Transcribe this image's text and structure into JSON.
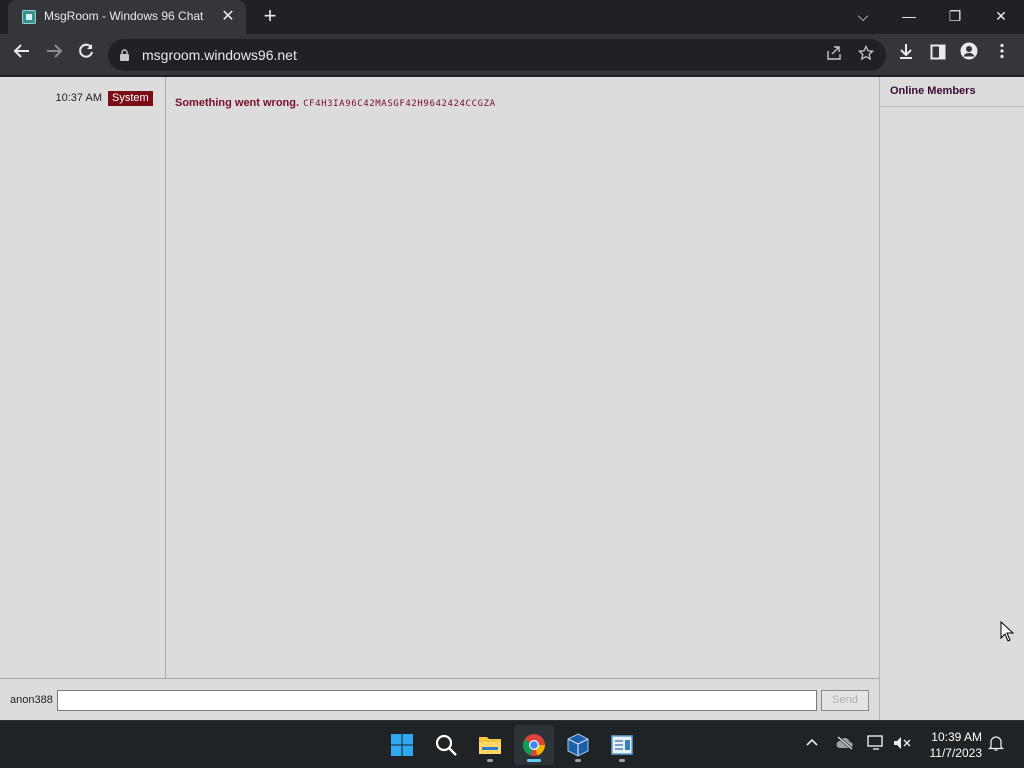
{
  "browser": {
    "tab_title": "MsgRoom - Windows 96 Chat",
    "tab_close": "✕",
    "new_tab": "+",
    "url": "msgroom.windows96.net",
    "window_controls": {
      "tab_search": "⌵",
      "minimize": "—",
      "restore": "❐",
      "close": "✕"
    },
    "icons": {
      "back": "back-arrow-icon",
      "forward": "forward-arrow-icon",
      "reload": "reload-icon",
      "lock": "lock-icon",
      "share": "share-icon",
      "bookmark": "star-icon",
      "download": "download-icon",
      "side_panel": "side-panel-icon",
      "profile": "profile-icon",
      "menu": "kebab-menu-icon"
    }
  },
  "chat": {
    "messages": [
      {
        "time": "10:37 AM",
        "sender": "System",
        "text": "Something went wrong.",
        "code": "CF4H3IA96C42MASGF42H9642424CCGZA"
      }
    ],
    "members_title": "Online Members",
    "nickname": "anon388",
    "input_value": "",
    "send_label": "Send"
  },
  "taskbar": {
    "apps": [
      "windows-start",
      "search",
      "file-explorer",
      "chrome",
      "virtualbox",
      "notepad"
    ],
    "clock_time": "10:39 AM",
    "clock_date": "11/7/2023"
  },
  "colors": {
    "page_bg": "#dcdcdc",
    "system_badge": "#7a0d16",
    "error_text": "#7a0d2a",
    "browser_dark": "#202124",
    "toolbar": "#35363a"
  }
}
